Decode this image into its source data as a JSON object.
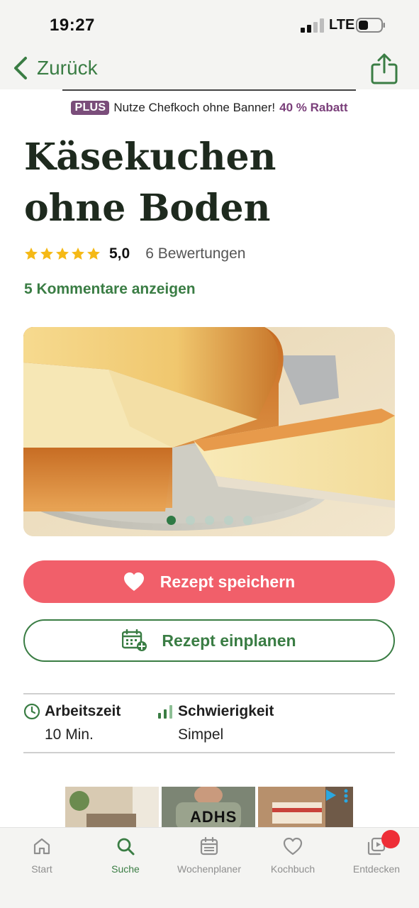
{
  "status_bar": {
    "time": "19:27",
    "network": "LTE",
    "signal_bars_filled": 2,
    "battery_level": 0.35
  },
  "nav": {
    "back_label": "Zurück",
    "back_icon": "chevron-left-icon",
    "share_icon": "share-icon"
  },
  "plus_banner": {
    "badge": "PLUS",
    "text": "Nutze Chefkoch ohne Banner!",
    "discount": "40 % Rabatt"
  },
  "recipe": {
    "title_line1": "Käsekuchen",
    "title_line2": "ohne Boden",
    "rating_value": "5,0",
    "rating_stars": 5,
    "rating_count": "6 Bewertungen",
    "comments_link": "5 Kommentare anzeigen",
    "image_count": 5,
    "active_image_index": 0
  },
  "actions": {
    "save_label": "Rezept speichern",
    "plan_label": "Rezept einplanen"
  },
  "info": {
    "worktime_title": "Arbeitszeit",
    "worktime_value": "10 Min.",
    "difficulty_title": "Schwierigkeit",
    "difficulty_value": "Simpel"
  },
  "ad": {
    "text": "ADHS"
  },
  "tab_bar": {
    "items": [
      {
        "label": "Start",
        "icon": "home-icon"
      },
      {
        "label": "Suche",
        "icon": "search-icon",
        "active": true
      },
      {
        "label": "Wochenplaner",
        "icon": "calendar-icon"
      },
      {
        "label": "Kochbuch",
        "icon": "heart-icon"
      },
      {
        "label": "Entdecken",
        "icon": "discover-icon",
        "has_badge": true
      }
    ]
  },
  "colors": {
    "brand_green": "#3a7d44",
    "save_red": "#f15f6a",
    "plus_purple": "#7a4d7a",
    "star_yellow": "#f5b916",
    "badge_red": "#ee2e37"
  }
}
